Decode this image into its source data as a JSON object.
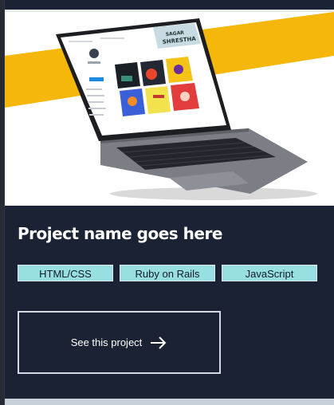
{
  "project": {
    "title": "Project name goes here",
    "tags": [
      "HTML/CSS",
      "Ruby on Rails",
      "JavaScript"
    ],
    "cta_label": "See this project"
  },
  "hero": {
    "screen_brand_line1": "SAGAR",
    "screen_brand_line2": "SHRESTHA"
  },
  "icons": {
    "cta": "arrow-right-icon"
  },
  "colors": {
    "card_bg": "#1b2234",
    "tag_bg": "#98dfe1",
    "accent_yellow": "#f5b70a",
    "text": "#ffffff"
  }
}
